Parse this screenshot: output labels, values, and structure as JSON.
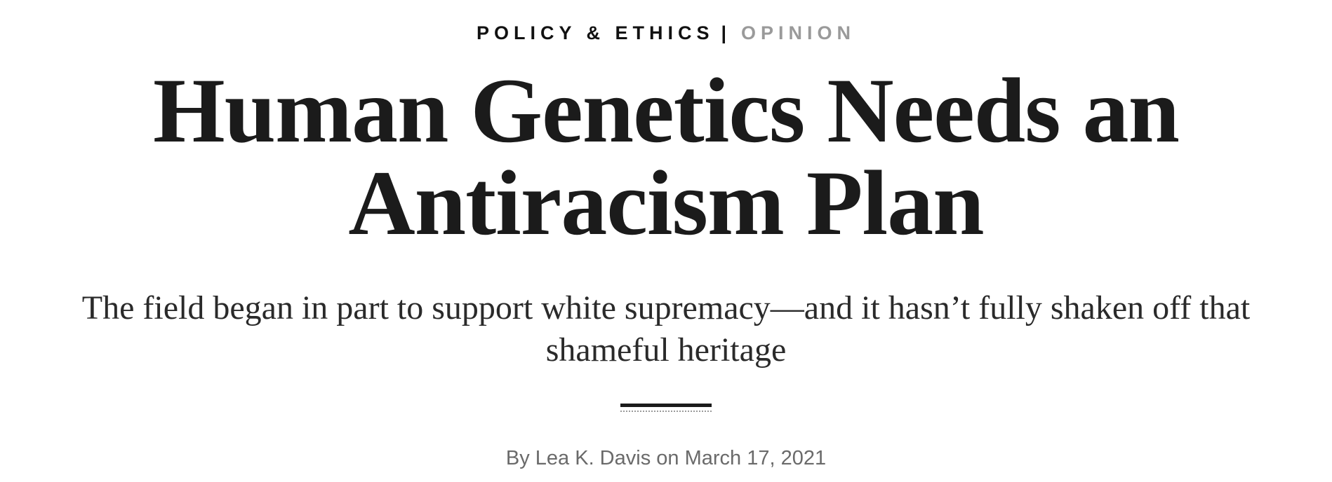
{
  "kicker": {
    "section": "POLICY & ETHICS",
    "separator": "|",
    "category": "OPINION"
  },
  "headline": {
    "line1": "Human Genetics Needs an",
    "line2": "Antiracism Plan"
  },
  "dek": {
    "line1": "The field began in part to support white supremacy—and it hasn’t fully shaken off that",
    "line2": "shameful heritage"
  },
  "byline": {
    "prefix": "By",
    "author": "Lea K. Davis",
    "on": "on",
    "date": "March 17, 2021"
  },
  "colors": {
    "text": "#1b1b1b",
    "muted": "#9a9a9a",
    "byline": "#6a6a6a"
  }
}
